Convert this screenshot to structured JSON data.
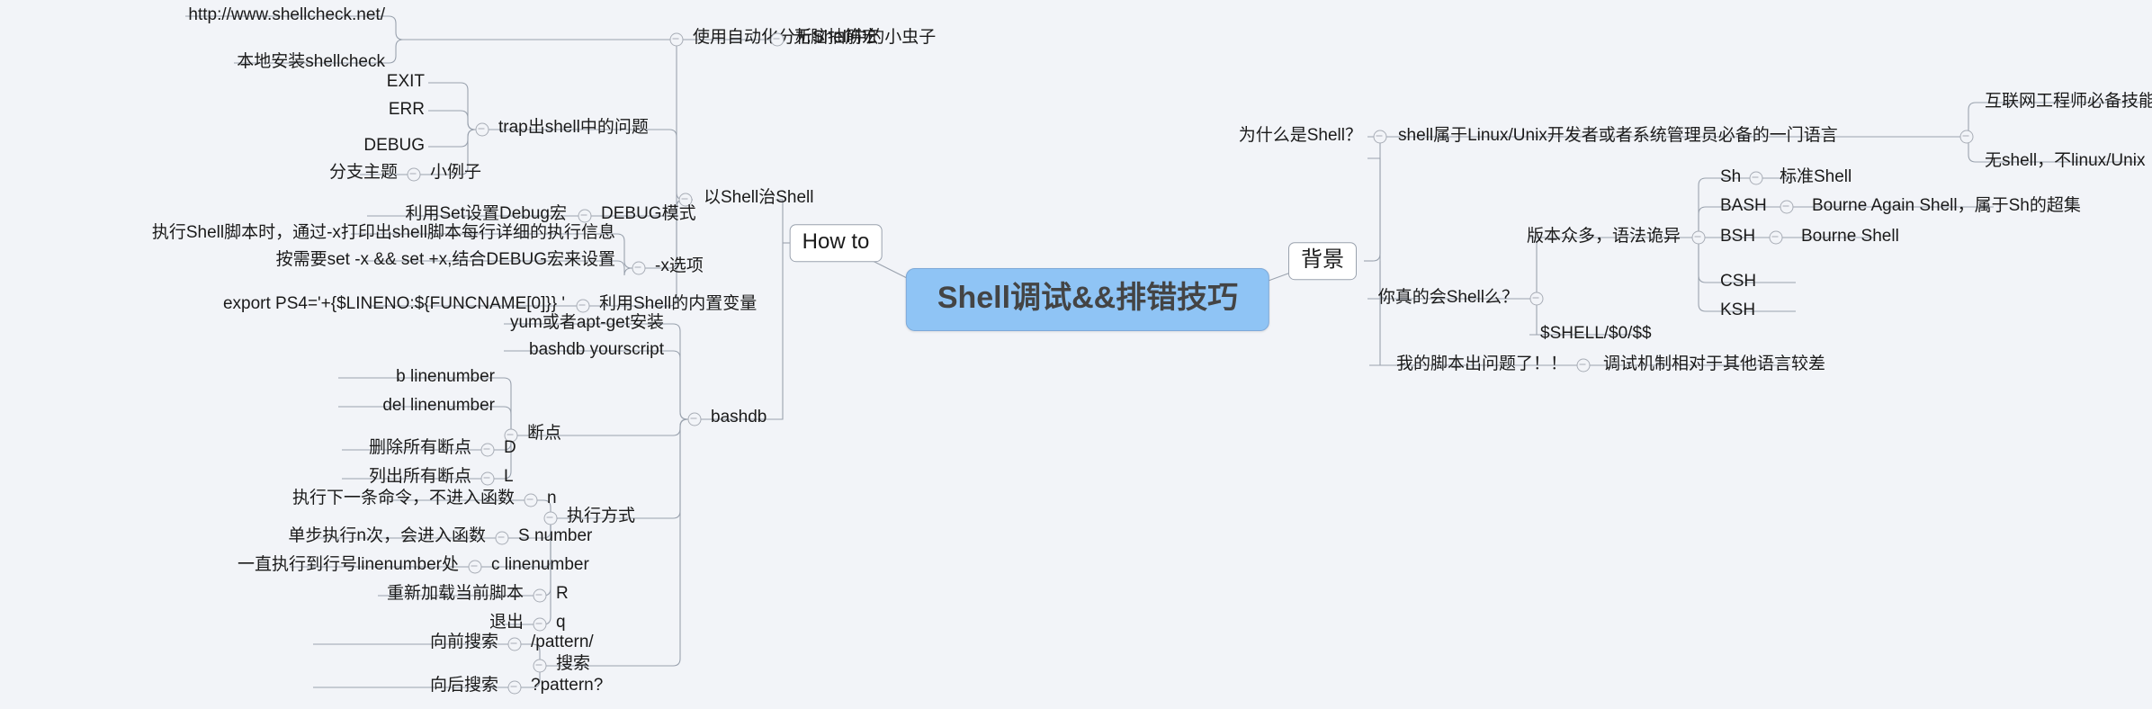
{
  "mindmap": {
    "title": "Shell调试&&排错技巧",
    "root": {
      "label": "Shell调试&&排错技巧",
      "color": "#8fc4f5"
    },
    "branches": [
      {
        "label": "How to",
        "side": "left"
      },
      {
        "label": "背景",
        "side": "right"
      }
    ]
  },
  "left": {
    "how_to": "How to",
    "shellcheck": {
      "topic": "使用自动化分析Shell中的小虫子",
      "tail": "无脑抽筋宏",
      "children": [
        "http://www.shellcheck.net/",
        "本地安装shellcheck"
      ]
    },
    "trap": {
      "topic": "trap出shell中的问题",
      "children": [
        "EXIT",
        "ERR",
        "DEBUG"
      ],
      "example": {
        "label": "分支主题",
        "value": "小例子"
      }
    },
    "shell_cure_shell": "以Shell治Shell",
    "debug_mode": {
      "topic": "DEBUG模式",
      "child": "利用Set设置Debug宏"
    },
    "x_option": {
      "topic": "-x选项",
      "children": [
        "执行Shell脚本时，通过-x打印出shell脚本每行详细的执行信息",
        "按需要set -x  && set +x,结合DEBUG宏来设置"
      ]
    },
    "builtin_var": {
      "topic": "利用Shell的内置变量",
      "child": "export PS4='+{$LINENO:${FUNCNAME[0]}} '"
    },
    "bashdb": {
      "topic": "bashdb",
      "install": "yum或者apt-get安装",
      "run": "bashdb yourscript",
      "breakpoints": {
        "topic": "断点",
        "items": [
          {
            "desc": "",
            "cmd": "b linenumber"
          },
          {
            "desc": "",
            "cmd": "del linenumber"
          },
          {
            "desc": "删除所有断点",
            "cmd": "D"
          },
          {
            "desc": "列出所有断点",
            "cmd": "L"
          }
        ]
      },
      "execution": {
        "topic": "执行方式",
        "items": [
          {
            "desc": "执行下一条命令，不进入函数",
            "cmd": "n"
          },
          {
            "desc": "单步执行n次，会进入函数",
            "cmd": "S number"
          },
          {
            "desc": "一直执行到行号linenumber处",
            "cmd": "c linenumber"
          },
          {
            "desc": "重新加载当前脚本",
            "cmd": "R"
          },
          {
            "desc": "退出",
            "cmd": "q"
          }
        ]
      },
      "search": {
        "topic": "搜索",
        "items": [
          {
            "desc": "向前搜索",
            "cmd": "/pattern/"
          },
          {
            "desc": "向后搜索",
            "cmd": "?pattern?"
          }
        ]
      }
    }
  },
  "right": {
    "background": "背景",
    "why_shell": {
      "label": "为什么是Shell？",
      "value": "shell属于Linux/Unix开发者或者系统管理员必备的一门语言",
      "children": [
        "互联网工程师必备技能",
        "无shell，不linux/Unix"
      ]
    },
    "really_know_shell": {
      "label": "你真的会Shell么？",
      "versions": {
        "label": "版本众多，语法诡异",
        "items": [
          {
            "name": "Sh",
            "desc": "标准Shell"
          },
          {
            "name": "BASH",
            "desc": "Bourne Again Shell，属于Sh的超集"
          },
          {
            "name": "BSH",
            "desc": "Bourne Shell"
          },
          {
            "name": "CSH",
            "desc": ""
          },
          {
            "name": "KSH",
            "desc": ""
          }
        ]
      },
      "shell_var": "$SHELL/$0/$$"
    },
    "script_problem": {
      "label": "我的脚本出问题了！！",
      "value": "调试机制相对于其他语言较差"
    }
  }
}
